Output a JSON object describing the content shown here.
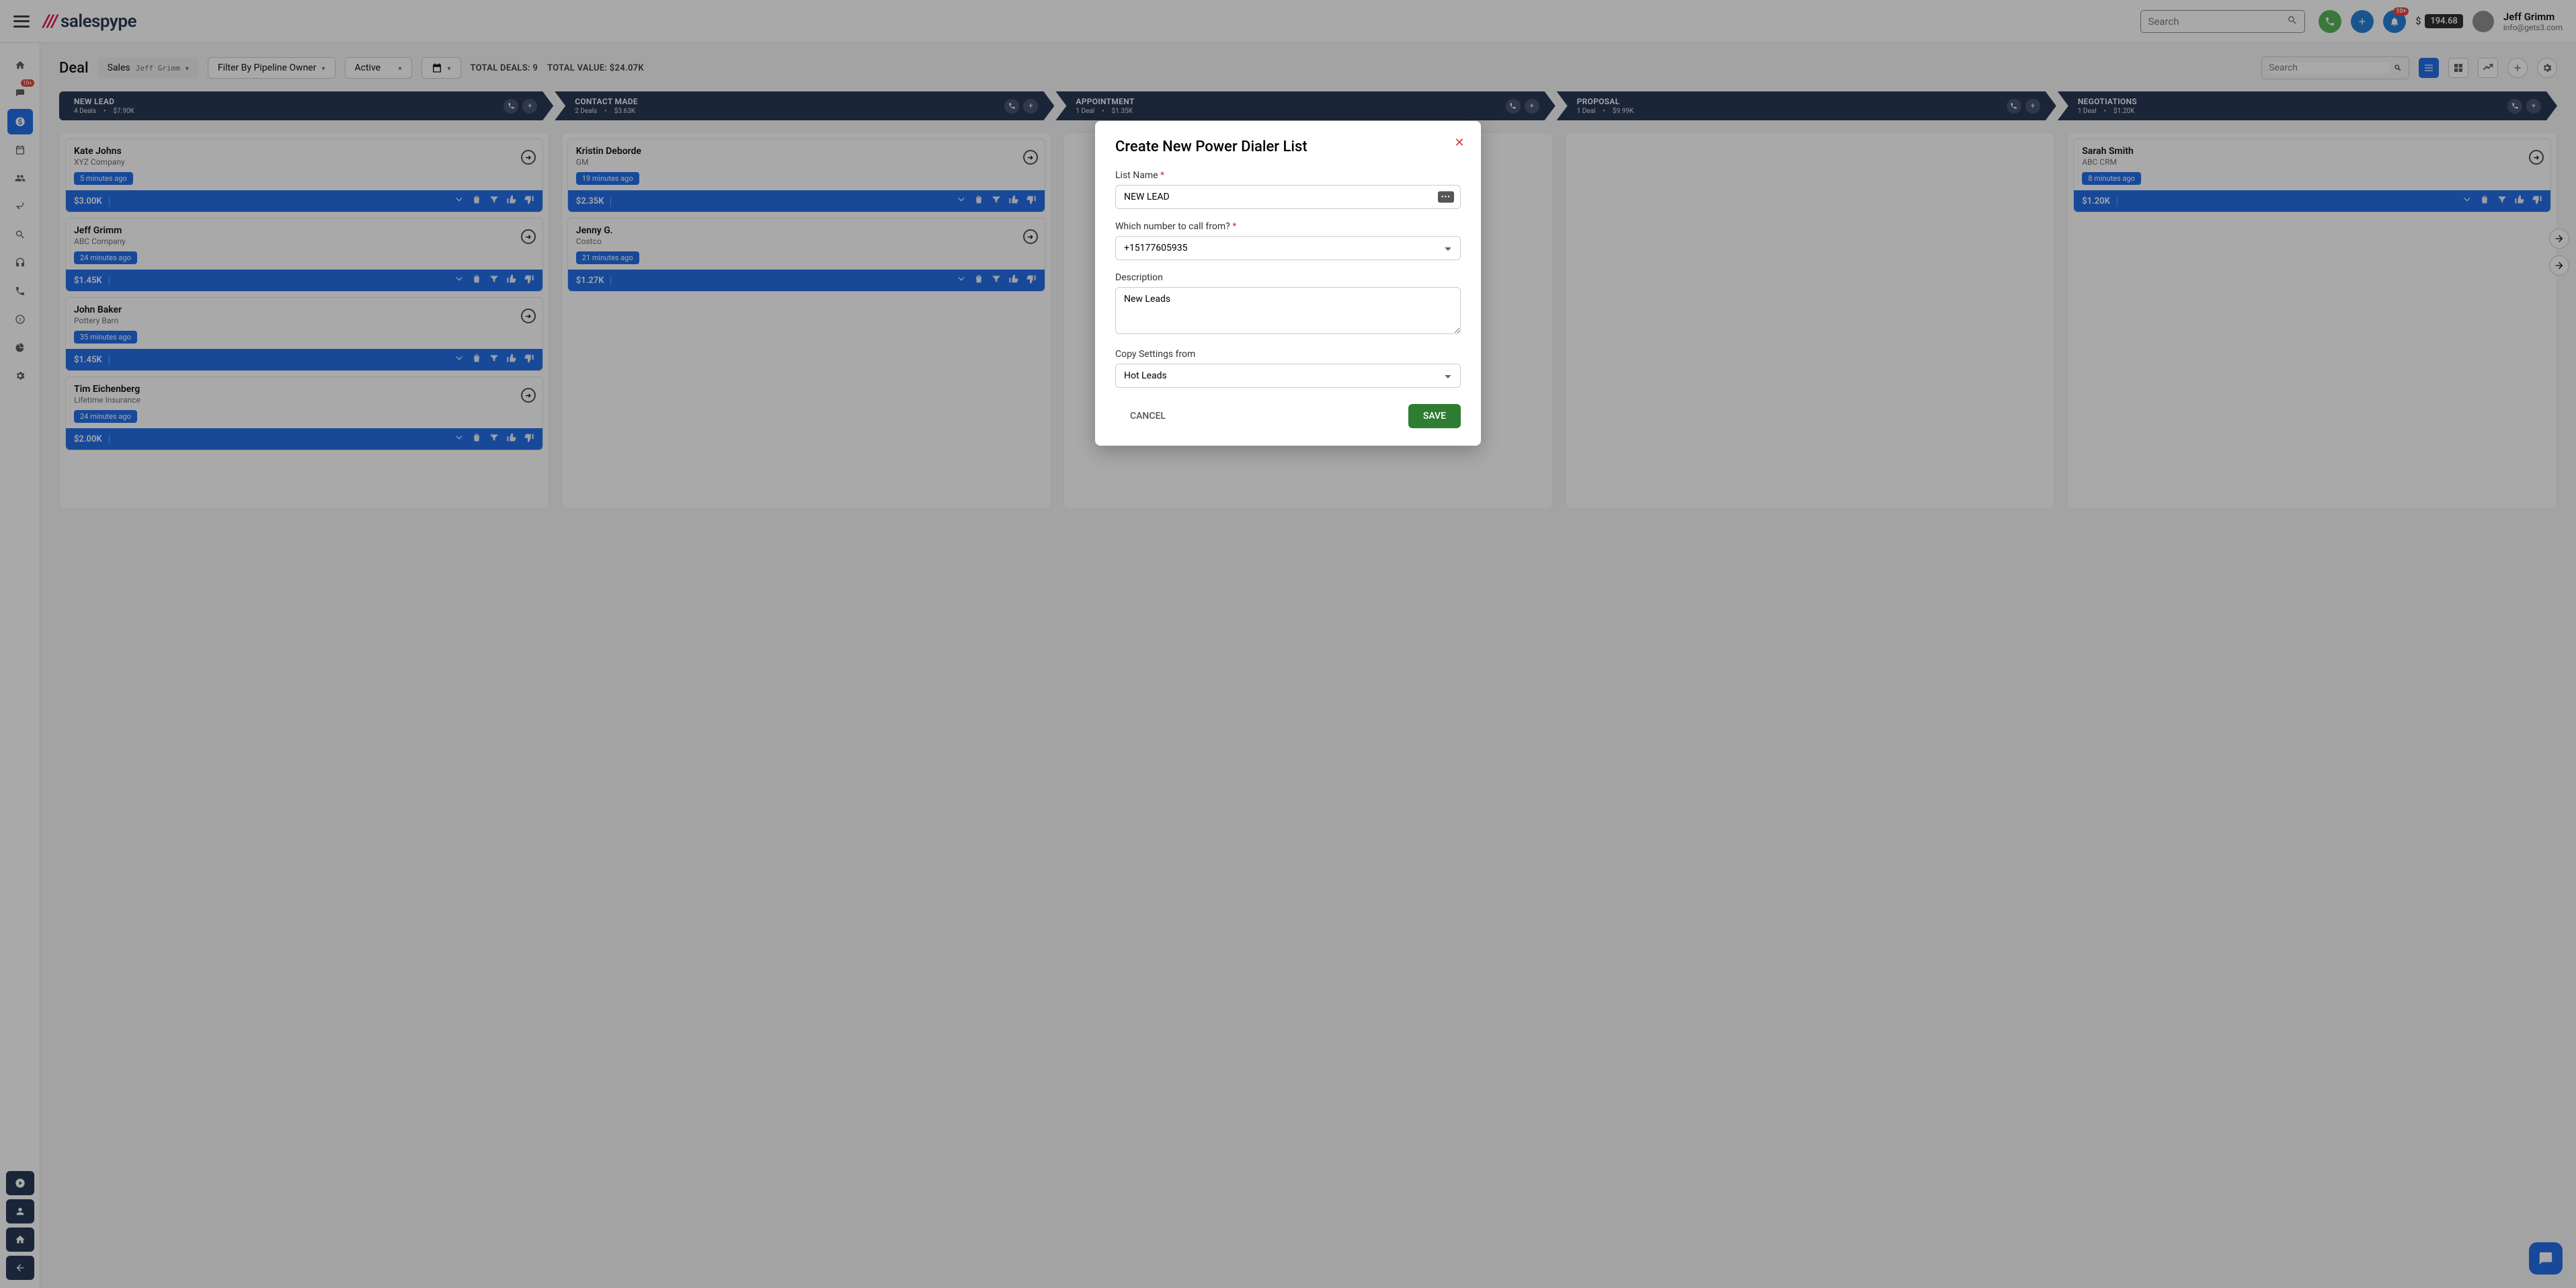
{
  "brand": {
    "name": "salespype"
  },
  "user": {
    "name": "Jeff Grimm",
    "email": "info@gets3.com"
  },
  "credit": {
    "currency": "$",
    "amount": "194.68"
  },
  "notification_badge": "10+",
  "inbox_badge": "10+",
  "top_search_placeholder": "Search",
  "page_title": "Deal",
  "pipeline_selector": {
    "label": "Sales",
    "owner": "Jeff Grimm"
  },
  "owner_filter": "Filter By Pipeline Owner",
  "status_filter": "Active",
  "totals": {
    "deals_label": "TOTAL DEALS:",
    "deals_value": "9",
    "value_label": "TOTAL VALUE:",
    "value_amount": "$24.07K"
  },
  "board_search_placeholder": "Search",
  "stages": [
    {
      "name": "NEW LEAD",
      "deals": "4 Deals",
      "value": "$7.90K"
    },
    {
      "name": "CONTACT MADE",
      "deals": "2 Deals",
      "value": "$3.63K"
    },
    {
      "name": "APPOINTMENT",
      "deals": "1 Deal",
      "value": "$1.35K"
    },
    {
      "name": "PROPOSAL",
      "deals": "1 Deal",
      "value": "$9.99K"
    },
    {
      "name": "NEGOTIATIONS",
      "deals": "1 Deal",
      "value": "$1.20K"
    }
  ],
  "columns": [
    [
      {
        "name": "Kate Johns",
        "company": "XYZ Company",
        "time": "5 minutes ago",
        "amount": "$3.00K"
      },
      {
        "name": "Jeff Grimm",
        "company": "ABC Company",
        "time": "24 minutes ago",
        "amount": "$1.45K"
      },
      {
        "name": "John Baker",
        "company": "Pottery Barn",
        "time": "35 minutes ago",
        "amount": "$1.45K"
      },
      {
        "name": "Tim Eichenberg",
        "company": "Lifetime Insurance",
        "time": "24 minutes ago",
        "amount": "$2.00K"
      }
    ],
    [
      {
        "name": "Kristin Deborde",
        "company": "GM",
        "time": "19 minutes ago",
        "amount": "$2.35K"
      },
      {
        "name": "Jenny G.",
        "company": "Costco",
        "time": "21 minutes ago",
        "amount": "$1.27K"
      }
    ],
    [],
    [],
    [
      {
        "name": "Sarah Smith",
        "company": "ABC CRM",
        "time": "8 minutes ago",
        "amount": "$1.20K"
      }
    ]
  ],
  "modal": {
    "title": "Create New Power Dialer List",
    "list_name_label": "List Name",
    "list_name_value": "NEW LEAD",
    "number_label": "Which number to call from?",
    "number_value": "+15177605935",
    "description_label": "Description",
    "description_value": "New Leads",
    "copy_label": "Copy Settings from",
    "copy_value": "Hot Leads",
    "cancel": "CANCEL",
    "save": "SAVE"
  }
}
